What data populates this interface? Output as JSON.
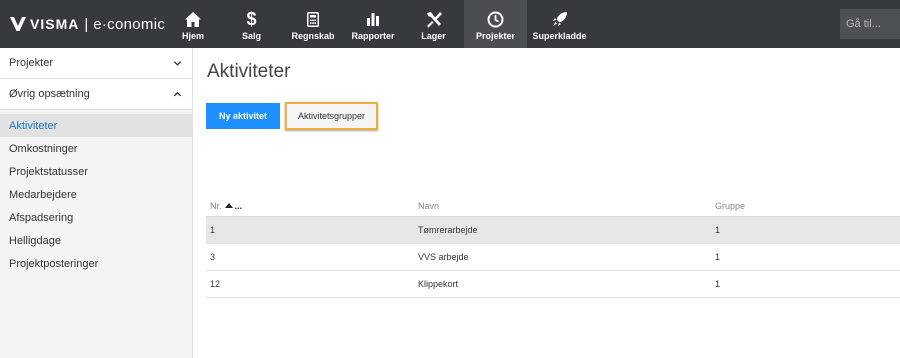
{
  "header": {
    "brand": "VISMA",
    "product": "e·conomic",
    "nav": [
      {
        "label": "Hjem",
        "icon": "home-icon",
        "width": 54
      },
      {
        "label": "Salg",
        "icon": "dollar-icon",
        "width": 63
      },
      {
        "label": "Regnskab",
        "icon": "calculator-icon",
        "width": 60
      },
      {
        "label": "Rapporter",
        "icon": "bar-chart-icon",
        "width": 60
      },
      {
        "label": "Lager",
        "icon": "tools-icon",
        "width": 61
      },
      {
        "label": "Projekter",
        "icon": "clock-icon",
        "width": 63,
        "active": true
      },
      {
        "label": "Superkladde",
        "icon": "rocket-icon",
        "width": 65
      }
    ],
    "search_placeholder": "Gå til..."
  },
  "sidebar": {
    "sections": [
      {
        "label": "Projekter",
        "expanded": false
      },
      {
        "label": "Øvrig opsætning",
        "expanded": true
      }
    ],
    "items": [
      {
        "label": "Aktiviteter",
        "active": true
      },
      {
        "label": "Omkostninger"
      },
      {
        "label": "Projektstatusser"
      },
      {
        "label": "Medarbejdere"
      },
      {
        "label": "Afspadsering"
      },
      {
        "label": "Helligdage"
      },
      {
        "label": "Projektposteringer"
      }
    ]
  },
  "main": {
    "title": "Aktiviteter",
    "primary_button": "Ny aktivitet",
    "secondary_button": "Aktivitetsgrupper",
    "table": {
      "columns": [
        "Nr.",
        "Navn",
        "Gruppe"
      ],
      "sort_more": "...",
      "rows": [
        {
          "nr": "1",
          "navn": "Tømrerarbejde",
          "gruppe": "1",
          "selected": true
        },
        {
          "nr": "3",
          "navn": "VVS arbejde",
          "gruppe": "1"
        },
        {
          "nr": "12",
          "navn": "Klippekort",
          "gruppe": "1"
        }
      ]
    }
  },
  "colors": {
    "topbar": "#36393e",
    "accent": "#1e90ff",
    "highlight_border": "#e9b33b",
    "active_link": "#1a73c7"
  }
}
